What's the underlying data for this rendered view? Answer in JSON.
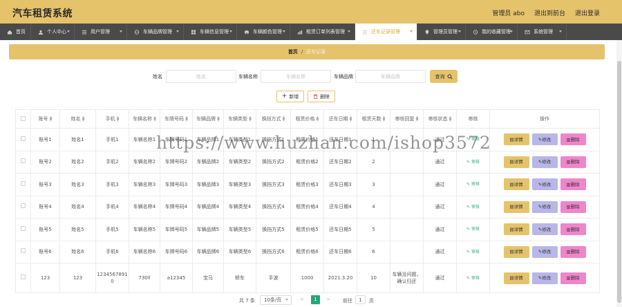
{
  "header": {
    "title": "汽车租赁系统",
    "user": "管理员 abo",
    "to_front": "退出到前台",
    "logout": "退出登录"
  },
  "nav": [
    {
      "label": "首页",
      "icon": "home-icon",
      "dropdown": false
    },
    {
      "label": "个人中心",
      "icon": "user-icon",
      "dropdown": true
    },
    {
      "label": "用户管理",
      "icon": "list-icon",
      "dropdown": true
    },
    {
      "label": "车辆品牌管理",
      "icon": "globe-icon",
      "dropdown": true
    },
    {
      "label": "车辆信息管理",
      "icon": "grid-icon",
      "dropdown": true
    },
    {
      "label": "车辆颜色管理",
      "icon": "car-icon",
      "dropdown": true
    },
    {
      "label": "租赁订单列表管理",
      "icon": "chart-icon",
      "dropdown": true
    },
    {
      "label": "还车记录管理",
      "icon": "list-icon",
      "dropdown": true,
      "active": true
    },
    {
      "label": "管理员管理",
      "icon": "pin-icon",
      "dropdown": true
    },
    {
      "label": "我的收藏管理",
      "icon": "clock-icon",
      "dropdown": true
    },
    {
      "label": "系统管理",
      "icon": "mail-icon",
      "dropdown": true
    }
  ],
  "breadcrumb": {
    "home": "首页",
    "sep": "/",
    "current": "还车记录"
  },
  "search": {
    "name_label": "姓名",
    "name_placeholder": "姓名",
    "car_label": "车辆名称",
    "car_placeholder": "车辆名称",
    "brand_label": "车辆品牌",
    "brand_placeholder": "车辆品牌",
    "query": "查询"
  },
  "actions": {
    "add": "新增",
    "delete": "删除"
  },
  "table": {
    "columns": [
      "账号",
      "姓名",
      "手机",
      "车辆名称",
      "车牌号码",
      "车辆品牌",
      "车辆类型",
      "换挡方式",
      "租赁价格",
      "还车日期",
      "租赁天数",
      "审核回复",
      "审核状态",
      "审核",
      "操作"
    ],
    "sortable": [
      true,
      true,
      true,
      true,
      true,
      true,
      true,
      true,
      true,
      true,
      true,
      true,
      true,
      false,
      false
    ],
    "audit_label": "审核",
    "op_detail": "详情",
    "op_edit": "修改",
    "op_delete": "删除",
    "rows": [
      {
        "cells": [
          "账号1",
          "姓名1",
          "手机1",
          "车辆名称1",
          "车牌号码1",
          "车辆品牌1",
          "车辆类型1",
          "换挡方式1",
          "租赁价格1",
          "还车日期1",
          "1",
          "",
          "通过"
        ]
      },
      {
        "cells": [
          "账号2",
          "姓名2",
          "手机2",
          "车辆名称2",
          "车牌号码2",
          "车辆品牌2",
          "车辆类型2",
          "换挡方式2",
          "租赁价格2",
          "还车日期2",
          "2",
          "",
          "通过"
        ]
      },
      {
        "cells": [
          "账号3",
          "姓名3",
          "手机3",
          "车辆名称3",
          "车牌号码3",
          "车辆品牌3",
          "车辆类型3",
          "换挡方式3",
          "租赁价格3",
          "还车日期3",
          "3",
          "",
          "通过"
        ]
      },
      {
        "cells": [
          "账号4",
          "姓名4",
          "手机4",
          "车辆名称4",
          "车牌号码4",
          "车辆品牌4",
          "车辆类型4",
          "换挡方式4",
          "租赁价格4",
          "还车日期4",
          "4",
          "",
          "通过"
        ]
      },
      {
        "cells": [
          "账号5",
          "姓名5",
          "手机5",
          "车辆名称5",
          "车牌号码5",
          "车辆品牌5",
          "车辆类型5",
          "换挡方式5",
          "租赁价格5",
          "还车日期5",
          "5",
          "",
          "通过"
        ]
      },
      {
        "cells": [
          "账号6",
          "姓名6",
          "手机6",
          "车辆名称6",
          "车牌号码6",
          "车辆品牌6",
          "车辆类型6",
          "换挡方式6",
          "租赁价格6",
          "还车日期6",
          "6",
          "",
          "通过"
        ]
      },
      {
        "cells": [
          "123",
          "123",
          "1234567891 0",
          "730ll",
          "a12345",
          "宝马",
          "轿车",
          "手波",
          "1000",
          "2021.3.20",
          "10",
          "车辆没问题，确认归还",
          "通过"
        ]
      }
    ]
  },
  "pagination": {
    "total": "共 7 条",
    "page_size": "10条/页",
    "prev": "<",
    "current": "1",
    "next": ">",
    "goto_label": "前往",
    "goto_value": "1",
    "page_unit": "页"
  },
  "watermark": "https://www.huzhan.com/ishop3572",
  "colors": {
    "accent": "#e5c36b",
    "nav_bg": "#4a4a4a",
    "active_text": "#e0a83a",
    "page_active": "#22a87a",
    "edit": "#b9b6e8",
    "delete": "#ef85cb",
    "audit": "#3aa87f"
  }
}
